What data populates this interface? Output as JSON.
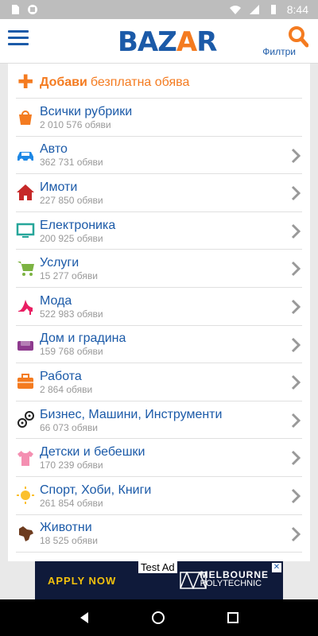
{
  "status_bar": {
    "time": "8:44"
  },
  "app_bar": {
    "logo_left": "BAZ",
    "logo_accent": "A",
    "logo_right": "R",
    "filters_label": "Филтри"
  },
  "add_listing": {
    "bold": "Добави",
    "rest": "безплатна обява"
  },
  "categories": [
    {
      "name": "Всички рубрики",
      "count": "2 010 576 обяви",
      "icon": "shopping-bag-icon",
      "color": "#f47b20",
      "chevron": false
    },
    {
      "name": "Авто",
      "count": "362 731 обяви",
      "icon": "car-icon",
      "color": "#1e88e5",
      "chevron": true
    },
    {
      "name": "Имоти",
      "count": "227 850 обяви",
      "icon": "house-icon",
      "color": "#c62828",
      "chevron": true
    },
    {
      "name": "Електроника",
      "count": "200 925 обяви",
      "icon": "monitor-icon",
      "color": "#26a69a",
      "chevron": true
    },
    {
      "name": "Услуги",
      "count": "15 277 обяви",
      "icon": "cart-icon",
      "color": "#7cb342",
      "chevron": true
    },
    {
      "name": "Мода",
      "count": "522 983 обяви",
      "icon": "high-heel-icon",
      "color": "#e91e63",
      "chevron": true
    },
    {
      "name": "Дом и градина",
      "count": "159 768 обяви",
      "icon": "sofa-icon",
      "color": "#8e3b8e",
      "chevron": true
    },
    {
      "name": "Работа",
      "count": "2 864 обяви",
      "icon": "briefcase-icon",
      "color": "#f47b20",
      "chevron": true
    },
    {
      "name": "Бизнес, Машини, Инструменти",
      "count": "66 073 обяви",
      "icon": "gears-icon",
      "color": "#222222",
      "chevron": true
    },
    {
      "name": "Детски и бебешки",
      "count": "170 239 обяви",
      "icon": "tshirt-icon",
      "color": "#f48fb1",
      "chevron": true
    },
    {
      "name": "Спорт, Хоби, Книги",
      "count": "261 854 обяви",
      "icon": "sun-icon",
      "color": "#fbc02d",
      "chevron": true
    },
    {
      "name": "Животни",
      "count": "18 525 обяви",
      "icon": "dog-icon",
      "color": "#6d3b1e",
      "chevron": true
    }
  ],
  "ad": {
    "cta": "APPLY NOW",
    "test_label": "Test Ad",
    "brand_line1": "MELBOURNE",
    "brand_line2": "POLYTECHNIC"
  },
  "colors": {
    "primary": "#1b5aa8",
    "accent": "#f47b20"
  }
}
